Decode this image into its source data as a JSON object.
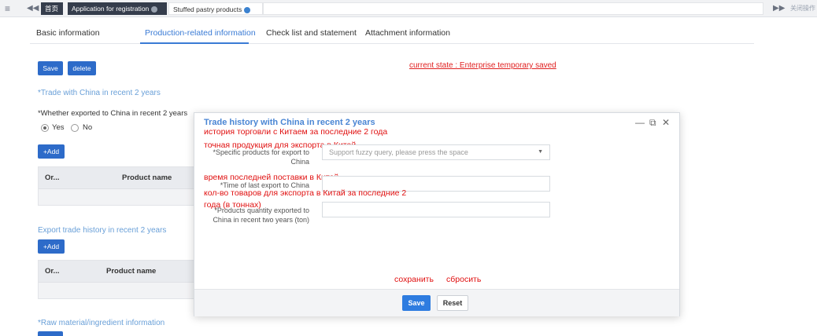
{
  "topbar": {
    "menu_icon": "hamburger-icon",
    "tabs": [
      {
        "label": "首页"
      },
      {
        "label": "Application for registration"
      },
      {
        "label": "Stuffed pastry products"
      }
    ],
    "close_label": "关闭操作"
  },
  "section_tabs": [
    {
      "label": "Basic information"
    },
    {
      "label": "Production-related information"
    },
    {
      "label": "Check list and statement"
    },
    {
      "label": "Attachment information"
    }
  ],
  "actions": {
    "save_label": "Save",
    "delete_label": "delete"
  },
  "current_state": "current state : Enterprise temporary saved",
  "trade_section": {
    "title": "*Trade with China in recent 2 years",
    "question": "*Whether exported to China in recent 2 years",
    "yes_label": "Yes",
    "no_label": "No",
    "selected": "Yes",
    "add_label": "+Add",
    "columns": [
      "Or...",
      "Product name"
    ]
  },
  "export_section": {
    "title": "Export trade history in recent 2 years",
    "add_label": "+Add",
    "columns": [
      "Or...",
      "Product name"
    ]
  },
  "raw_material": {
    "title": "*Raw material/ingredient information"
  },
  "modal": {
    "title": "Trade history with China in recent 2 years",
    "ru_title": "история торговли с Китаем за последние 2 года",
    "ru_products": "точная продукция для экспорта в Китай",
    "ru_time": "время последней поставки в Китай",
    "ru_qty_line1": "кол-во товаров для экспорта в Китай за последние 2",
    "ru_qty_line2": "года (в тоннах)",
    "ru_save": "сохранить",
    "ru_reset": "сбросить",
    "fields": {
      "products_label": "*Specific products for export to China",
      "products_placeholder": "Support fuzzy query, please press the space",
      "time_label": "*Time of last export to China",
      "qty_label": "*Products quantity exported to China in recent two years (ton)"
    },
    "save_label": "Save",
    "reset_label": "Reset"
  }
}
